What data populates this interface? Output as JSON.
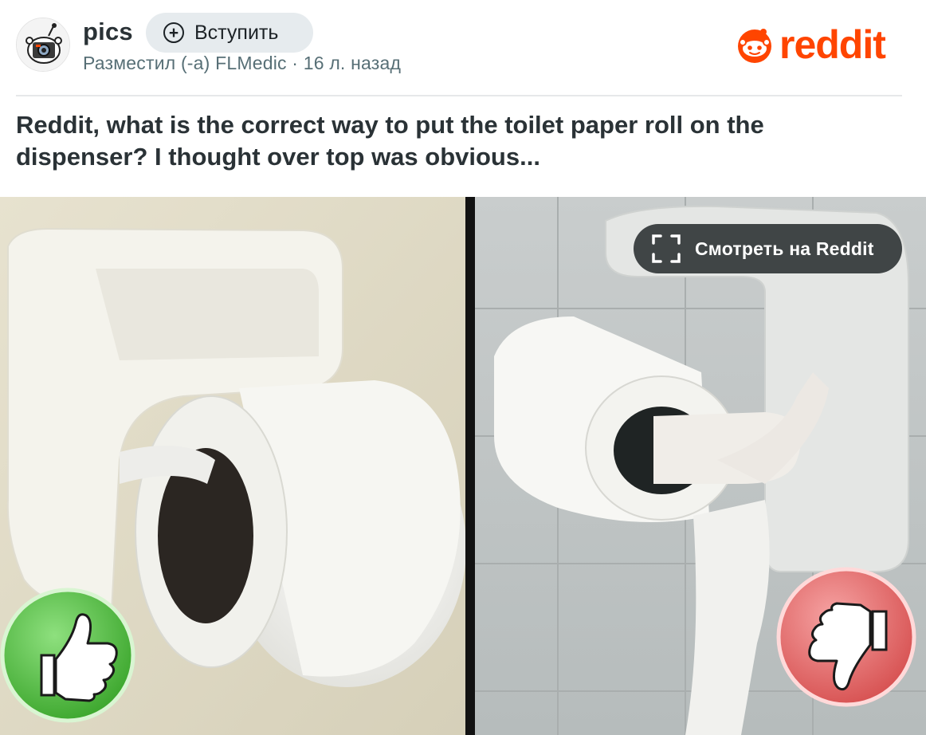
{
  "header": {
    "subreddit": "pics",
    "join_label": "Вступить",
    "meta": "Разместил (-а) FLMedic · 16 л. назад",
    "brand": "reddit"
  },
  "post": {
    "title": "Reddit, what is the correct way to put the toilet paper roll on the dispenser? I thought over top was obvious..."
  },
  "media": {
    "view_label": "Смотреть на Reddit",
    "left_icon": "thumbs-up-icon",
    "right_icon": "thumbs-down-icon"
  },
  "colors": {
    "brand": "#ff4500",
    "thumbs_up": "#4cbb3b",
    "thumbs_down": "#e06a6a"
  }
}
